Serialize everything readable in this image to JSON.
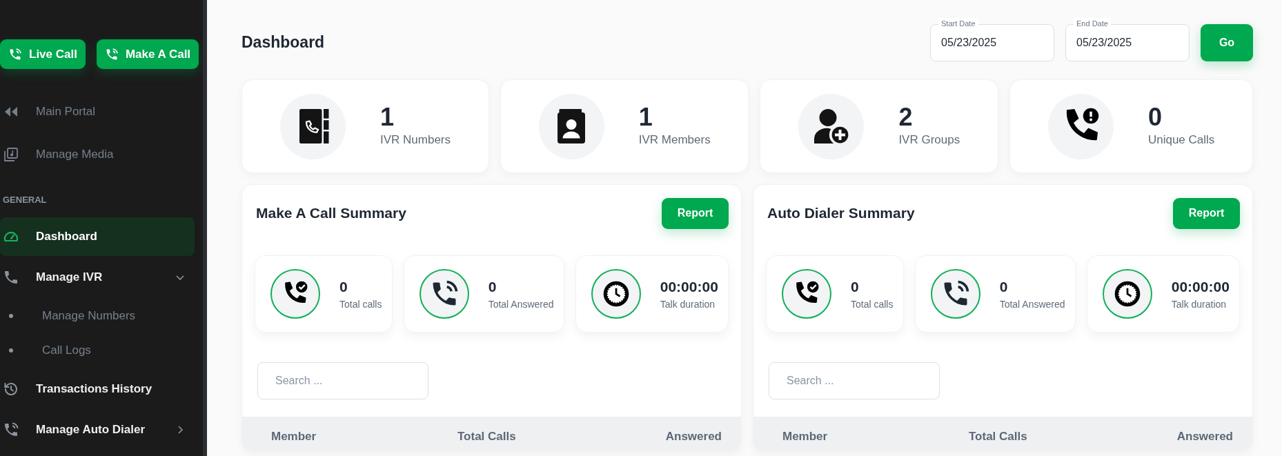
{
  "sidebar": {
    "actions": [
      {
        "label": "Live Call"
      },
      {
        "label": "Make A Call"
      }
    ],
    "items": [
      {
        "kind": "external",
        "label": "Main Portal"
      },
      {
        "kind": "external",
        "label": "Manage Media"
      },
      {
        "kind": "heading",
        "label": "GENERAL"
      },
      {
        "kind": "link",
        "label": "Dashboard",
        "selected": true
      },
      {
        "kind": "link",
        "label": "Manage IVR",
        "selected": false,
        "expanded": true
      },
      {
        "kind": "sub",
        "label": "Manage Numbers",
        "selected": false
      },
      {
        "kind": "sub",
        "label": "Call Logs",
        "selected": false
      },
      {
        "kind": "link",
        "label": "Transactions History",
        "selected": false
      },
      {
        "kind": "link",
        "label": "Manage Auto Dialer",
        "selected": false,
        "expanded": false
      }
    ]
  },
  "page_title": "Dashboard",
  "filters": {
    "start": {
      "label": "Start Date",
      "value": "05/23/2025"
    },
    "end": {
      "label": "End Date",
      "value": "05/23/2025"
    },
    "button": "Go"
  },
  "stats": [
    {
      "value": "1",
      "label": "IVR Numbers"
    },
    {
      "value": "1",
      "label": "IVR Members"
    },
    {
      "value": "2",
      "label": "IVR Groups"
    },
    {
      "value": "0",
      "label": "Unique Calls"
    }
  ],
  "summaries": [
    {
      "title": "Make A Call Summary",
      "button": "Report",
      "metrics": [
        {
          "value": "0",
          "label": "Total calls"
        },
        {
          "value": "0",
          "label": "Total Answered"
        },
        {
          "value": "00:00:00",
          "label": "Talk duration"
        }
      ],
      "search": {
        "placeholder": "Search ..."
      },
      "columns": [
        "Member",
        "Total Calls",
        "Answered"
      ]
    },
    {
      "title": "Auto Dialer Summary",
      "button": "Report",
      "metrics": [
        {
          "value": "0",
          "label": "Total calls"
        },
        {
          "value": "0",
          "label": "Total Answered"
        },
        {
          "value": "00:00:00",
          "label": "Talk duration"
        }
      ],
      "search": {
        "placeholder": "Search ..."
      },
      "columns": [
        "Member",
        "Total Calls",
        "Answered"
      ]
    }
  ]
}
